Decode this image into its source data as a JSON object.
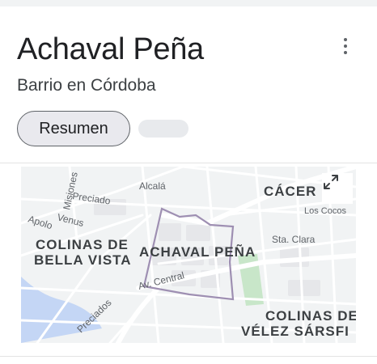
{
  "place": {
    "name": "Achaval Peña",
    "category": "Barrio en Córdoba"
  },
  "tabs": {
    "active_label": "Resumen"
  },
  "map": {
    "area_label": "ACHAVAL PEÑA",
    "neighborhoods": {
      "colinas_bella_vista": [
        "COLINAS DE",
        "BELLA VISTA"
      ],
      "caceres": "CÁCER",
      "colinas_velez": [
        "COLINAS DE",
        "VÉLEZ SÁRSFI"
      ]
    },
    "streets": {
      "misiones": "Misiones",
      "preciado": "Preciado",
      "alcala": "Alcalá",
      "apolo": "Apolo",
      "venus": "Venus",
      "los_cocos": "Los Cocos",
      "sta_clara": "Sta. Clara",
      "av_central": "Av. Central",
      "preciados": "Preciados"
    },
    "colors": {
      "background": "#f1f3f4",
      "roads": "#ffffff",
      "boundary": "#9e8fb2",
      "park": "#c8e6c9",
      "water": "#c4d6f5"
    }
  },
  "icons": {
    "menu": "more-vert-icon",
    "expand": "expand-icon"
  }
}
